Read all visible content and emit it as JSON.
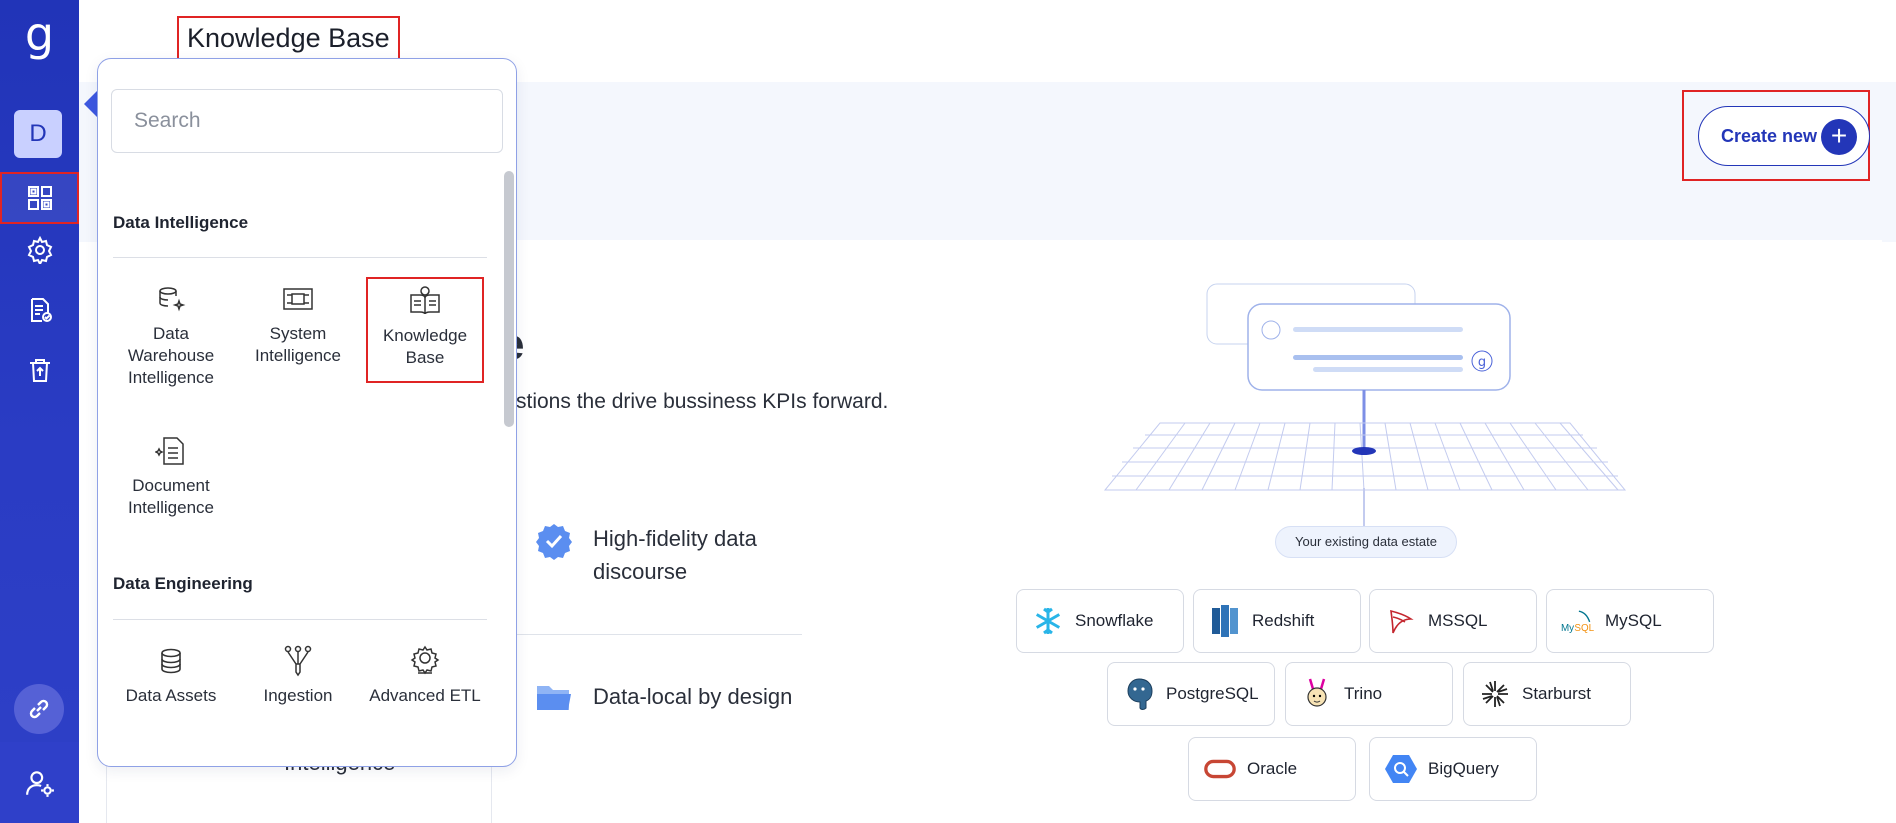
{
  "app": {
    "logo_glyph": "g",
    "avatar_initial": "D",
    "page_title": "Knowledge Base"
  },
  "rail": {
    "items": [
      {
        "icon": "grid-icon"
      },
      {
        "icon": "gear-icon"
      },
      {
        "icon": "document-check-icon"
      },
      {
        "icon": "trash-icon"
      },
      {
        "icon": "link-icon"
      },
      {
        "icon": "user-settings-icon"
      }
    ]
  },
  "header": {
    "create_label": "Create new",
    "create_icon": "plus-icon"
  },
  "hero": {
    "title_fragment": "e",
    "subtitle_fragment": "stions the drive bussiness KPIs forward.",
    "features": [
      {
        "icon": "verified-badge-icon",
        "text": "High-fidelity data discourse"
      },
      {
        "icon": "folder-icon",
        "text": "Data-local by design"
      }
    ],
    "under_fragment": "Intelligence"
  },
  "illustration": {
    "estate_label": "Your existing data estate",
    "sources": [
      {
        "name": "Snowflake",
        "icon": "snowflake-icon"
      },
      {
        "name": "Redshift",
        "icon": "redshift-icon"
      },
      {
        "name": "MSSQL",
        "icon": "mssql-icon"
      },
      {
        "name": "MySQL",
        "icon": "mysql-icon"
      },
      {
        "name": "PostgreSQL",
        "icon": "postgresql-icon"
      },
      {
        "name": "Trino",
        "icon": "trino-icon"
      },
      {
        "name": "Starburst",
        "icon": "starburst-icon"
      },
      {
        "name": "Oracle",
        "icon": "oracle-icon"
      },
      {
        "name": "BigQuery",
        "icon": "bigquery-icon"
      }
    ]
  },
  "menu": {
    "search_placeholder": "Search",
    "sections": [
      {
        "title": "Data Intelligence",
        "items": [
          {
            "label": "Data Warehouse Intelligence",
            "icon": "database-sparkle-icon"
          },
          {
            "label": "System Intelligence",
            "icon": "chip-icon"
          },
          {
            "label": "Knowledge Base",
            "icon": "book-lightbulb-icon",
            "selected": true
          },
          {
            "label": "Document Intelligence",
            "icon": "document-sparkle-icon"
          }
        ]
      },
      {
        "title": "Data Engineering",
        "items": [
          {
            "label": "Data Assets",
            "icon": "database-icon"
          },
          {
            "label": "Ingestion",
            "icon": "funnel-icon"
          },
          {
            "label": "Advanced ETL",
            "icon": "gear-hand-icon"
          }
        ]
      }
    ]
  },
  "colors": {
    "rail": "#2134b8",
    "accent": "#2336b8",
    "highlight": "#e02424"
  }
}
